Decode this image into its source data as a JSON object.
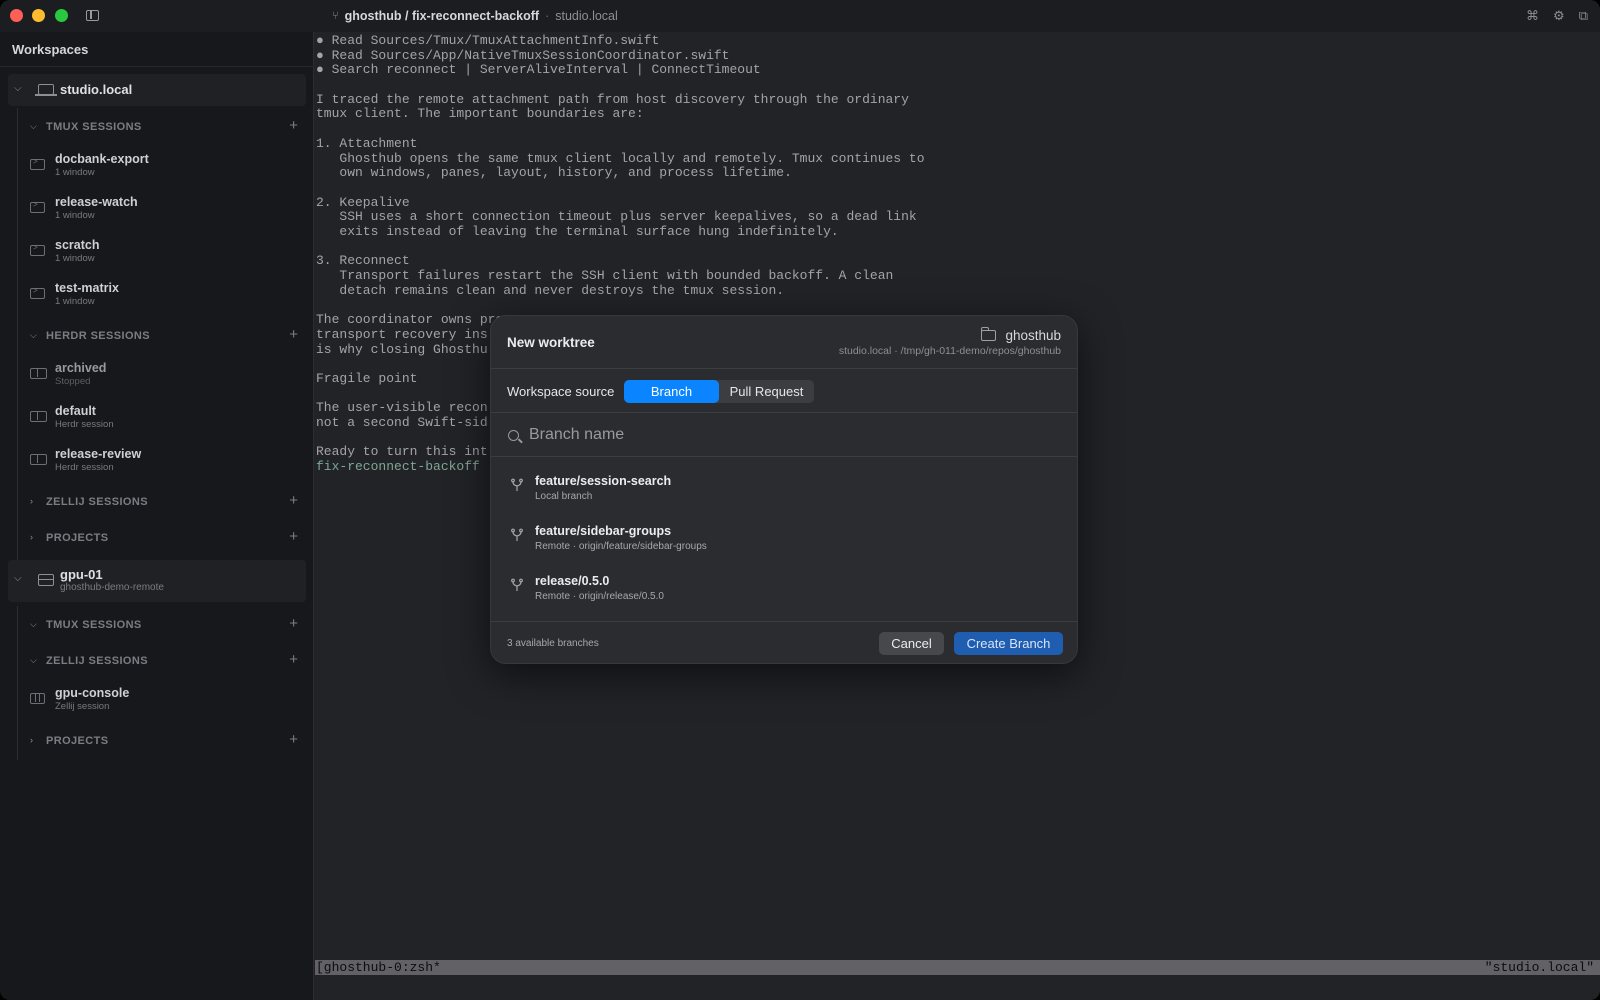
{
  "titlebar": {
    "branch_icon": "branch-icon",
    "title": "ghosthub / fix-reconnect-backoff",
    "separator": "·",
    "host": "studio.local",
    "icons": [
      "command-icon",
      "gear-icon",
      "sidebar-layout-icon"
    ]
  },
  "sidebar": {
    "header": "Workspaces",
    "hosts": [
      {
        "name": "studio.local",
        "icon": "laptop-icon",
        "sections": [
          {
            "label": "TMUX SESSIONS",
            "expanded": true,
            "items": [
              {
                "name": "docbank-export",
                "sub": "1 window"
              },
              {
                "name": "release-watch",
                "sub": "1 window"
              },
              {
                "name": "scratch",
                "sub": "1 window"
              },
              {
                "name": "test-matrix",
                "sub": "1 window"
              }
            ]
          },
          {
            "label": "HERDR SESSIONS",
            "expanded": true,
            "items": [
              {
                "name": "archived",
                "sub": "Stopped"
              },
              {
                "name": "default",
                "sub": "Herdr session"
              },
              {
                "name": "release-review",
                "sub": "Herdr session"
              }
            ]
          },
          {
            "label": "ZELLIJ SESSIONS",
            "expanded": false,
            "items": []
          },
          {
            "label": "PROJECTS",
            "expanded": false,
            "items": []
          }
        ]
      },
      {
        "name": "gpu-01",
        "sub": "ghosthub-demo-remote",
        "icon": "server-icon",
        "sections": [
          {
            "label": "TMUX SESSIONS",
            "expanded": true,
            "items": []
          },
          {
            "label": "ZELLIJ SESSIONS",
            "expanded": true,
            "items": [
              {
                "name": "gpu-console",
                "sub": "Zellij session"
              }
            ]
          },
          {
            "label": "PROJECTS",
            "expanded": false,
            "items": []
          }
        ]
      }
    ]
  },
  "terminal": {
    "lines": [
      "● Read Sources/Tmux/TmuxAttachmentInfo.swift",
      "● Read Sources/App/NativeTmuxSessionCoordinator.swift",
      "● Search reconnect | ServerAliveInterval | ConnectTimeout",
      "",
      "I traced the remote attachment path from host discovery through the ordinary",
      "tmux client. The important boundaries are:",
      "",
      "1. Attachment",
      "   Ghosthub opens the same tmux client locally and remotely. Tmux continues to",
      "   own windows, panes, layout, history, and process lifetime.",
      "",
      "2. Keepalive",
      "   SSH uses a short connection timeout plus server keepalives, so a dead link",
      "   exits instead of leaving the terminal surface hung indefinitely.",
      "",
      "3. Reconnect",
      "   Transport failures restart the SSH client with bounded backoff. A clean",
      "   detach remains clean and never destroys the tmux session.",
      "",
      "The coordinator owns pro",
      "transport recovery ins",
      "is why closing Ghosthu",
      "",
      "Fragile point",
      "",
      "The user-visible recon",
      "not a second Swift-sid",
      "",
      "Ready to turn this int",
      "fix-reconnect-backoff"
    ],
    "status_left": "[ghosthub-0:zsh*",
    "status_right": "\"studio.local\""
  },
  "modal": {
    "title": "New worktree",
    "repo_icon": "folder-icon",
    "repo_name": "ghosthub",
    "repo_path": "studio.local · /tmp/gh-011-demo/repos/ghosthub",
    "source_label": "Workspace source",
    "source_options": [
      "Branch",
      "Pull Request"
    ],
    "source_selected": "Branch",
    "search_placeholder": "Branch name",
    "search_value": "",
    "branches": [
      {
        "name": "feature/session-search",
        "sub": "Local branch"
      },
      {
        "name": "feature/sidebar-groups",
        "sub": "Remote · origin/feature/sidebar-groups"
      },
      {
        "name": "release/0.5.0",
        "sub": "Remote · origin/release/0.5.0"
      }
    ],
    "count_label": "3 available branches",
    "cancel_label": "Cancel",
    "create_label": "Create Branch"
  },
  "colors": {
    "accent": "#0a84ff",
    "create_button": "#1f5db0",
    "close": "#fe5f57",
    "minimize": "#febc2e",
    "zoom": "#28c840"
  }
}
